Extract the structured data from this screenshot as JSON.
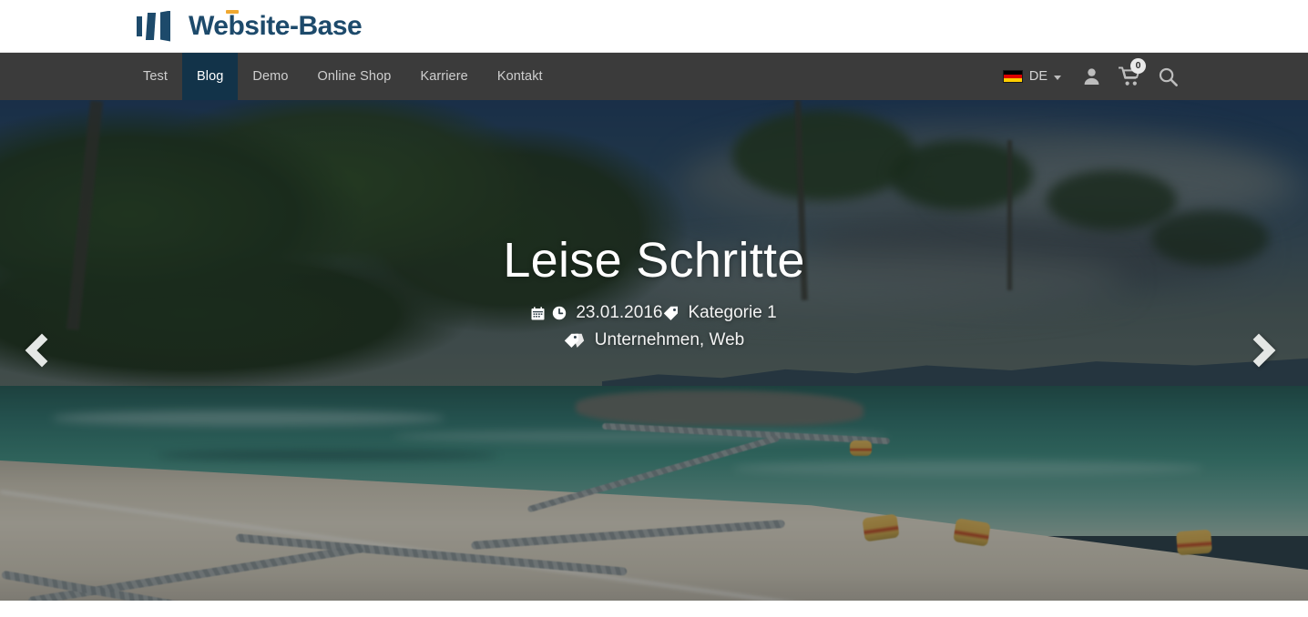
{
  "brand": {
    "name": "Website-Base",
    "logo_icon": "book-pages-icon",
    "primary_color": "#1d4a6b",
    "accent_color": "#f0a830"
  },
  "navbar": {
    "background_color": "#3b3b3b",
    "active_color": "#123349",
    "items": [
      {
        "label": "Test",
        "active": false
      },
      {
        "label": "Blog",
        "active": true
      },
      {
        "label": "Demo",
        "active": false
      },
      {
        "label": "Online Shop",
        "active": false
      },
      {
        "label": "Karriere",
        "active": false
      },
      {
        "label": "Kontakt",
        "active": false
      }
    ],
    "language": {
      "label": "DE",
      "flag_icon": "german-flag-icon",
      "caret_icon": "chevron-down-icon"
    },
    "account_icon": "user-icon",
    "cart_icon": "shopping-cart-icon",
    "cart_count": "0",
    "search_icon": "search-icon"
  },
  "hero": {
    "title": "Leise Schritte",
    "calendar_icon": "calendar-icon",
    "clock_icon": "clock-icon",
    "date": "23.01.2016",
    "category_icon": "tag-icon",
    "category": "Kategorie 1",
    "tags_icon": "tags-icon",
    "tags": "Unternehmen, Web",
    "prev_icon": "chevron-left-icon",
    "next_icon": "chevron-right-icon",
    "image_description": "tropical beach with palm trees, ropes and buoys on sand"
  }
}
